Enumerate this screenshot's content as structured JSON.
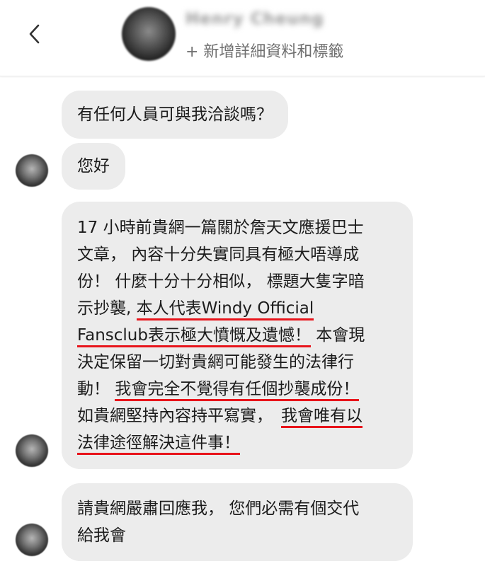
{
  "header": {
    "back_icon": "chevron-left-icon",
    "contact_name": "Henry Cheung",
    "subtitle": "+ 新增詳細資料和標籤"
  },
  "messages": [
    {
      "text": "有任何人員可與我洽談嗎？"
    },
    {
      "text": "您好"
    },
    {
      "lines": {
        "l1": "17 小時前貴網一篇關於詹天文應援巴士",
        "l2": "文章， 內容十分失實同具有極大唔導成",
        "l3": "份！ 什麼十分十分相似， 標題大隻字暗",
        "l4a": "示抄襲, ",
        "l4b": "本人代表Windy Official",
        "l5a": "Fansclub表示極大憤慨及遺憾！",
        "l5b": " 本會現",
        "l6": "決定保留一切對貴網可能發生的法律行",
        "l7a": "動！ ",
        "l7b": "我會完全不覺得有任個抄襲成份！",
        "l8a": "如貴網堅持內容持平寫實，",
        "l8b": "我會唯有以",
        "l9": "法律途徑解決這件事！"
      }
    },
    {
      "lines": {
        "l1": "請貴網嚴肅回應我， 您們必需有個交代",
        "l2": "給我會"
      }
    }
  ],
  "colors": {
    "bubble": "#ececec",
    "underline": "#e8141b",
    "subtitle": "#6f6f6f"
  }
}
